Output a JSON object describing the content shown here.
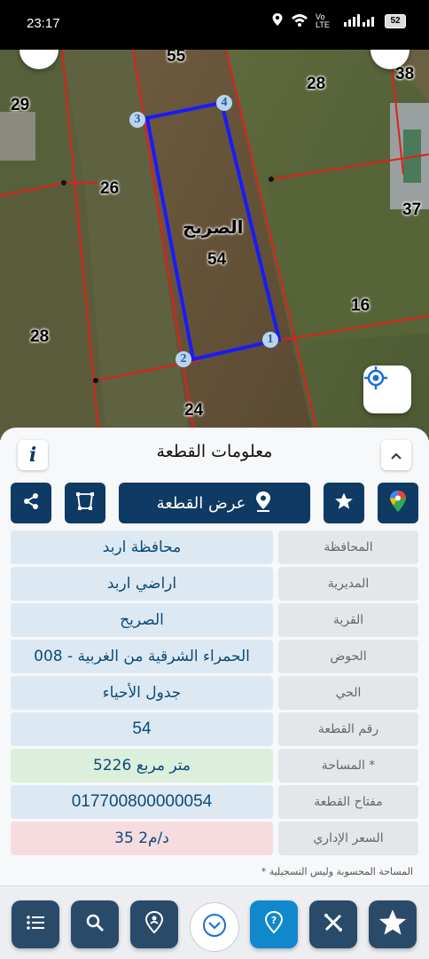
{
  "status_bar": {
    "time": "23:17",
    "network": "Vo LTE",
    "battery": "52",
    "icons": [
      "location-icon",
      "wifi-icon",
      "signal-icon",
      "battery-icon"
    ]
  },
  "map": {
    "parcel_labels": [
      "55",
      "28",
      "38",
      "29",
      "26",
      "37",
      "16",
      "28",
      "24"
    ],
    "selected_parcel_name": "الصريح",
    "selected_parcel_number": "54",
    "vertices": [
      "1",
      "2",
      "3",
      "4"
    ]
  },
  "panel": {
    "title": "معلومات القطعة",
    "info_label": "i",
    "view_parcel_label": "عرض القطعة",
    "rows": [
      {
        "label": "المحافظة",
        "value": "محافظة اربد"
      },
      {
        "label": "المديرية",
        "value": "اراضي اربد"
      },
      {
        "label": "القرية",
        "value": "الصريح"
      },
      {
        "label": "الحوض",
        "value": "الحمراء الشرقية من الغربية - 008"
      },
      {
        "label": "الحي",
        "value": "جدول الأحياء"
      },
      {
        "label": "رقم القطعة",
        "value": "54"
      },
      {
        "label": "المساحة *",
        "value": "5226 متر مربع"
      },
      {
        "label": "مفتاح القطعة",
        "value": "017700800000054"
      },
      {
        "label": "السعر الإداري",
        "value": "35 د/م2"
      }
    ],
    "footnote": "* المساحة المحسوبة وليس التسجيلية"
  },
  "colors": {
    "primary": "#0f3a63",
    "accent": "#1188cc",
    "parcel_outline": "#1a1aff",
    "boundary": "#e0201a"
  }
}
